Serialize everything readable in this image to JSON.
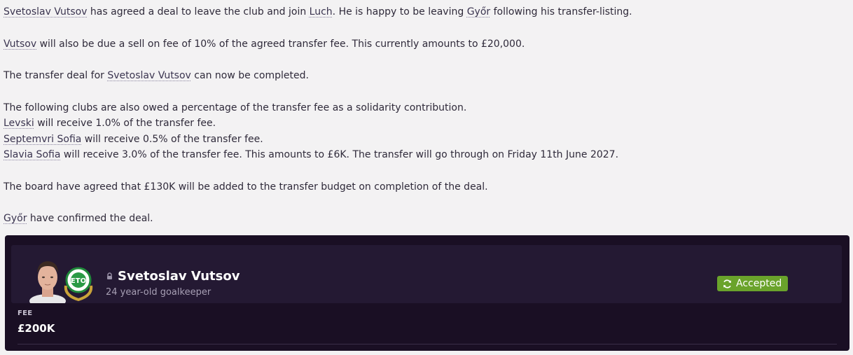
{
  "news": {
    "p1": {
      "player": "Svetoslav Vutsov",
      "t1": " has agreed a deal to leave the club and join ",
      "club": "Luch",
      "t2": ". He is happy to be leaving ",
      "from": "Győr",
      "t3": " following his transfer-listing."
    },
    "p2": {
      "player": "Vutsov",
      "t1": " will also be due a sell on fee of 10% of the agreed transfer fee. This currently amounts to £20,000."
    },
    "p3": {
      "t1": "The transfer deal for ",
      "player": "Svetoslav Vutsov",
      "t2": " can now be completed."
    },
    "p4": {
      "intro": "The following clubs are also owed a percentage of the transfer fee as a solidarity contribution.",
      "club1": "Levski",
      "c1": " will receive 1.0% of the transfer fee.",
      "club2": "Septemvri Sofia",
      "c2": " will receive 0.5% of the transfer fee.",
      "club3": "Slavia Sofia",
      "c3": " will receive 3.0% of the transfer fee. This amounts to £6K. The transfer will go through on Friday 11th June 2027."
    },
    "p5": "The board have agreed that £130K will be added to the transfer budget on completion of the deal.",
    "p6": {
      "club": "Győr",
      "t1": " have confirmed the deal."
    }
  },
  "card": {
    "player_name": "Svetoslav Vutsov",
    "player_desc": "24 year-old goalkeeper",
    "status": "Accepted",
    "status_color": "#6aa32b",
    "fee_label": "FEE",
    "fee_value": "£200K",
    "icons": [
      "player-face",
      "club-crest",
      "lock-icon",
      "refresh-icon"
    ]
  }
}
